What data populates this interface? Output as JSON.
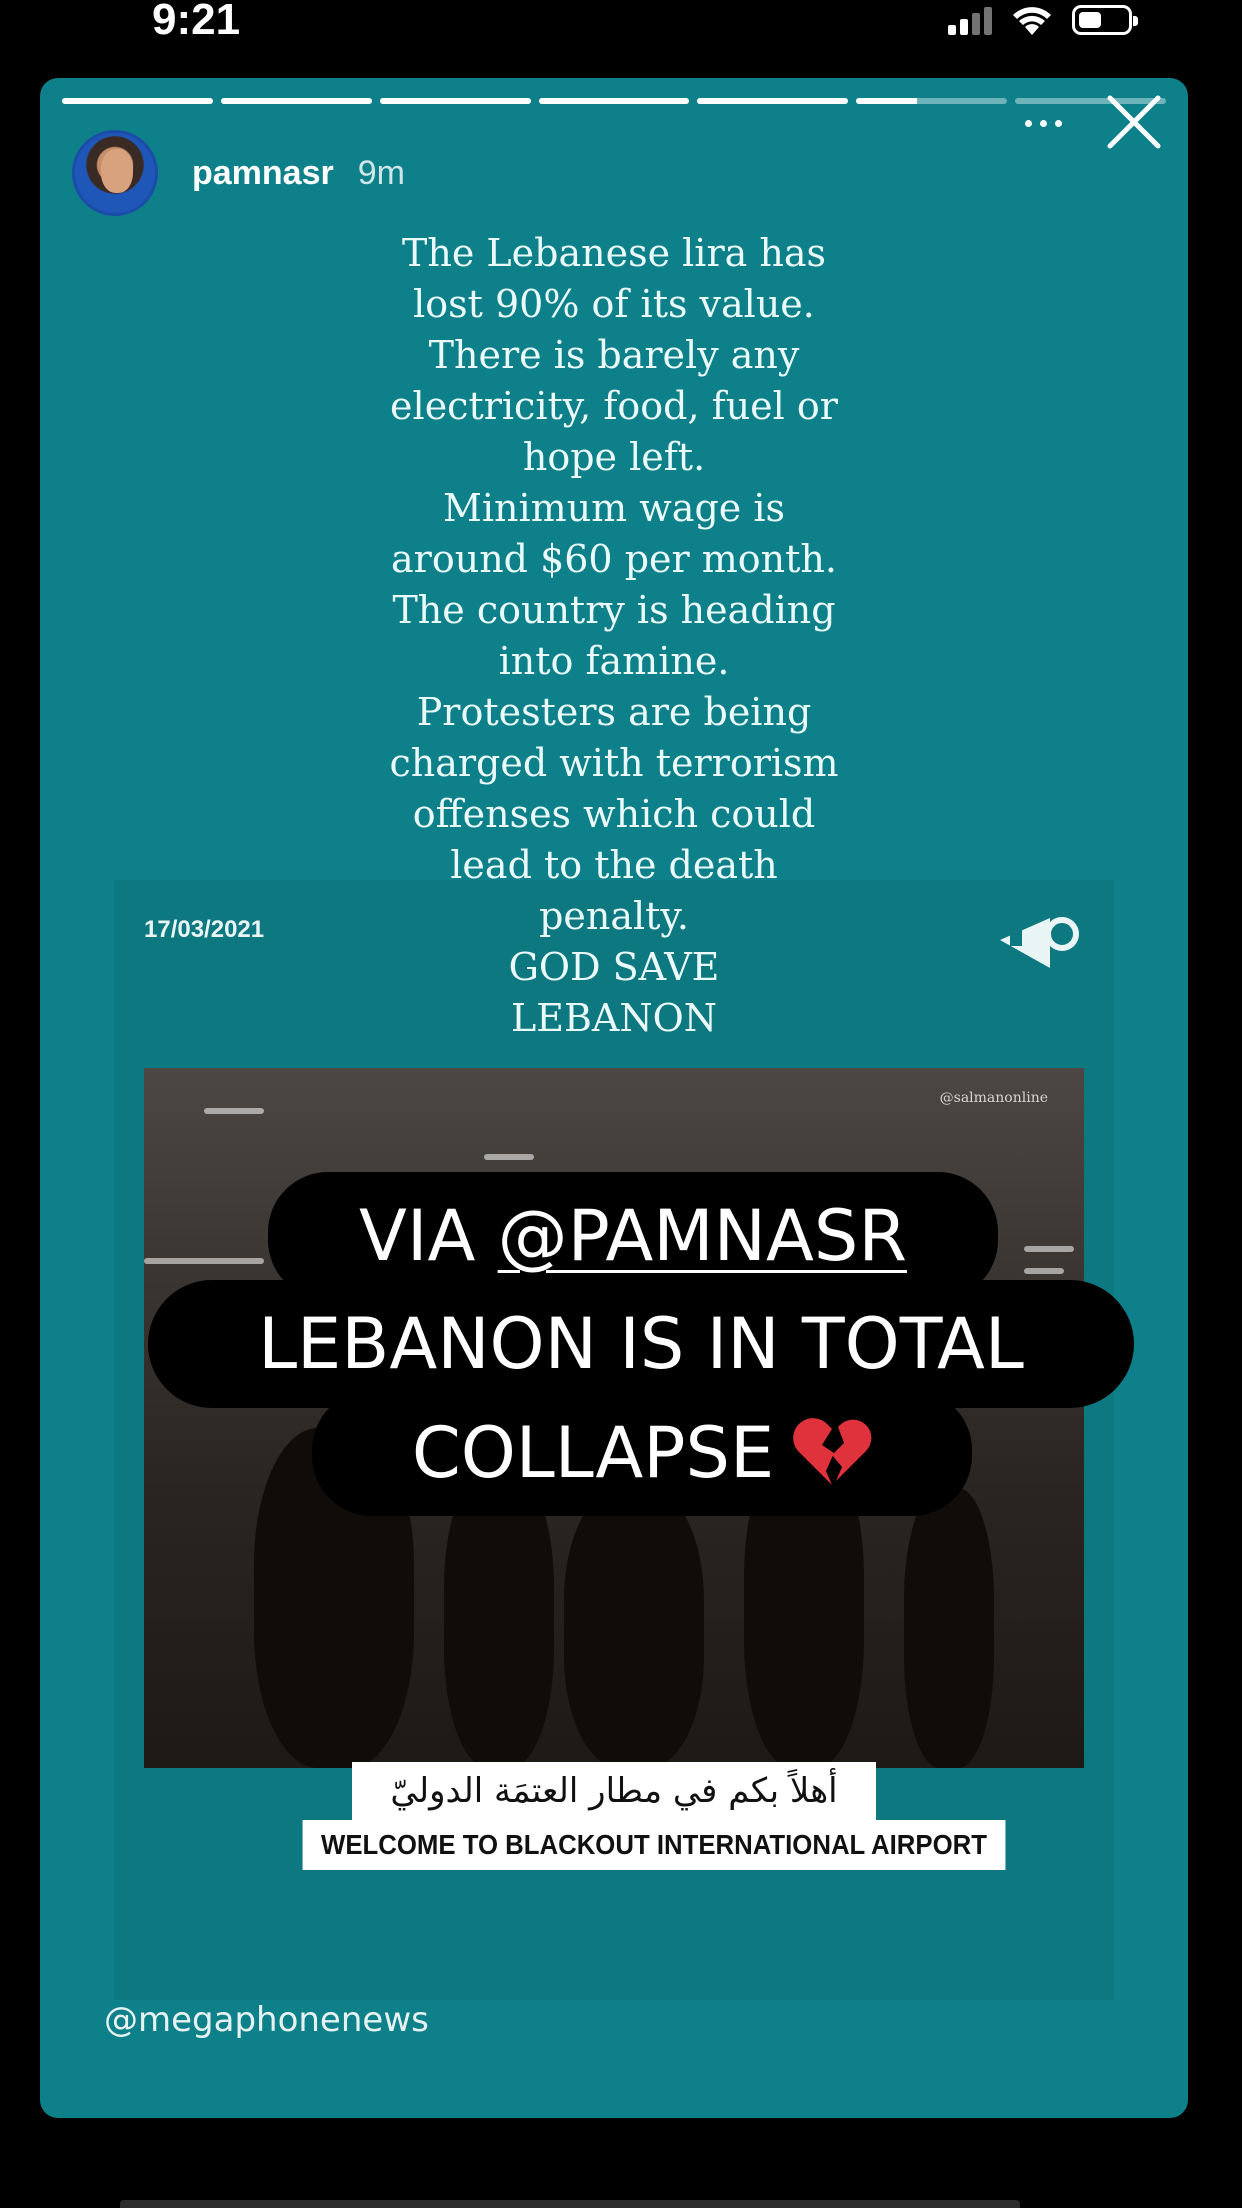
{
  "status_bar": {
    "time": "9:21"
  },
  "story": {
    "progress_segments": 7,
    "current_segment": 6,
    "current_segment_progress": 0.4,
    "username": "pamnasr",
    "time_ago": "9m",
    "post_text": "The Lebanese lira has\nlost 90% of its value.\nThere is barely any\nelectricity, food, fuel or\nhope left.\nMinimum wage is\naround $60 per month.\nThe country is heading\ninto famine.\nProtesters are being\ncharged with terrorism\noffenses which could\nlead to the death\npenalty.\nGOD SAVE\nLEBANON"
  },
  "news_card": {
    "date": "17/03/2021",
    "video_credit": "@salmanonline",
    "caption_arabic": "أهلاً بكم في مطار العتمَة الدوليّ",
    "caption_english": "WELCOME TO BLACKOUT INTERNATIONAL AIRPORT",
    "handle": "@megaphonenews"
  },
  "sticker": {
    "line1_prefix": "VIA ",
    "line1_mention": "@PAMNASR",
    "line2": "LEBANON IS IN TOTAL",
    "line3": "COLLAPSE",
    "emoji_icon": "broken-heart-icon"
  },
  "colors": {
    "story_bg": "#0e808a",
    "card_bg": "#0d7880"
  }
}
